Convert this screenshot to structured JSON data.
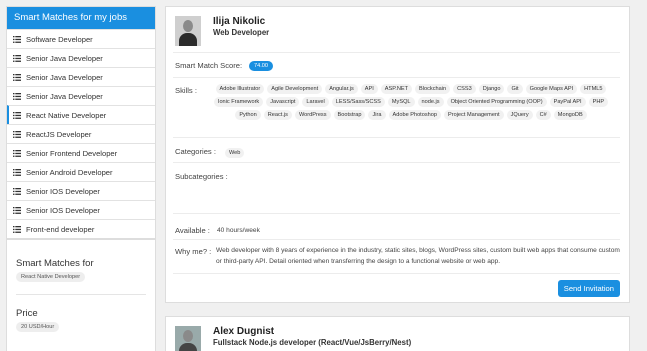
{
  "sidebar": {
    "header": "Smart Matches for my jobs",
    "items": [
      {
        "label": "Software Developer"
      },
      {
        "label": "Senior Java Developer"
      },
      {
        "label": "Senior Java Developer"
      },
      {
        "label": "Senior Java Developer"
      },
      {
        "label": "React Native Developer"
      },
      {
        "label": "ReactJS Developer"
      },
      {
        "label": "Senior Frontend Developer"
      },
      {
        "label": "Senior Android Developer"
      },
      {
        "label": "Senior IOS Developer"
      },
      {
        "label": "Senior IOS Developer"
      },
      {
        "label": "Front-end developer"
      }
    ],
    "active_index": 4
  },
  "filters": {
    "smart_matches_label": "Smart Matches for",
    "smart_matches_value": "React Native Developer",
    "price_label": "Price",
    "price_value": "20 USD/Hour"
  },
  "candidates": [
    {
      "name": "Ilija Nikolic",
      "title": "Web Developer",
      "score_label": "Smart Match Score:",
      "score": "74.00",
      "skills_label": "Skills :",
      "skills": [
        "Adobe Illustrator",
        "Agile Development",
        "Angular.js",
        "API",
        "ASP.NET",
        "Blockchain",
        "CSS3",
        "Django",
        "Git",
        "Google Maps API",
        "HTML5",
        "Ionic Framework",
        "Javascript",
        "Laravel",
        "LESS/Sass/SCSS",
        "MySQL",
        "node.js",
        "Object Oriented Programming (OOP)",
        "PayPal API",
        "PHP",
        "Python",
        "React.js",
        "WordPress",
        "Bootstrap",
        "Jira",
        "Adobe Photoshop",
        "Project Management",
        "JQuery",
        "C#",
        "MongoDB"
      ],
      "categories_label": "Categories :",
      "categories": [
        "Web"
      ],
      "subcategories_label": "Subcategories :",
      "available_label": "Available :",
      "available": "40 hours/week",
      "why_label": "Why me? :",
      "why": "Web developer with 8 years of experience in the industry, static sites, blogs, WordPress sites, custom built web apps that consume custom or third-party API. Detail oriented when transferring the design to a functional website or web app.",
      "invite_label": "Send Invitation"
    },
    {
      "name": "Alex Dugnist",
      "title": "Fullstack Node.js developer (React/Vue/JsBerry/Nest)"
    }
  ],
  "colors": {
    "accent": "#1a8fe0"
  },
  "icons": {
    "list": "list-icon"
  }
}
